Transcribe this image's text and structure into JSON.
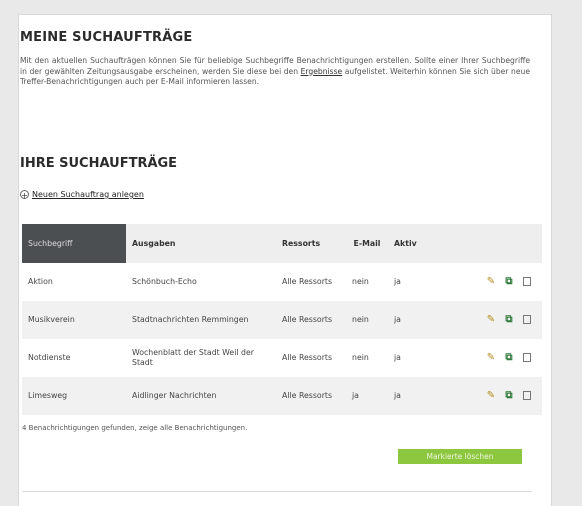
{
  "section1": {
    "title": "MEINE SUCHAUFTRÄGE",
    "intro_before": "Mit den aktuellen Suchaufträgen können Sie für beliebige Suchbegriffe Benachrichtigungen erstellen. Sollte einer Ihrer Suchbegriffe in der gewählten Zeitungsausgabe erscheinen, werden Sie diese bei den ",
    "intro_link": "Ergebnisse",
    "intro_after": " aufgelistet. Weiterhin können Sie sich über neue Treffer-Benachrichtigungen auch per E-Mail informieren lassen."
  },
  "section2": {
    "title": "IHRE SUCHAUFTRÄGE",
    "new_link": "Neuen Suchauftrag anlegen"
  },
  "table": {
    "headers": {
      "suchbegriff": "Suchbegriff",
      "ausgaben": "Ausgaben",
      "ressorts": "Ressorts",
      "email": "E-Mail",
      "aktiv": "Aktiv"
    },
    "rows": [
      {
        "term": "Aktion",
        "edition": "Schönbuch-Echo",
        "ressort": "Alle Ressorts",
        "email": "nein",
        "active": "ja"
      },
      {
        "term": "Musikverein",
        "edition": "Stadtnachrichten Remmingen",
        "ressort": "Alle Ressorts",
        "email": "nein",
        "active": "ja"
      },
      {
        "term": "Notdienste",
        "edition": "Wochenblatt der Stadt Weil der Stadt",
        "ressort": "Alle Ressorts",
        "email": "nein",
        "active": "ja"
      },
      {
        "term": "Limesweg",
        "edition": "Aidlinger Nachrichten",
        "ressort": "Alle Ressorts",
        "email": "ja",
        "active": "ja"
      }
    ]
  },
  "footer": {
    "count_text": "4 Benachrichtigungen gefunden, zeige alle Benachrichtigungen.",
    "button_label": "Markierte löschen"
  },
  "icons": {
    "edit": "pencil-icon",
    "copy": "copy-icon",
    "select": "checkbox"
  },
  "colors": {
    "sorted_header_bg": "#4c4f51",
    "button_bg": "#8dc63f"
  }
}
